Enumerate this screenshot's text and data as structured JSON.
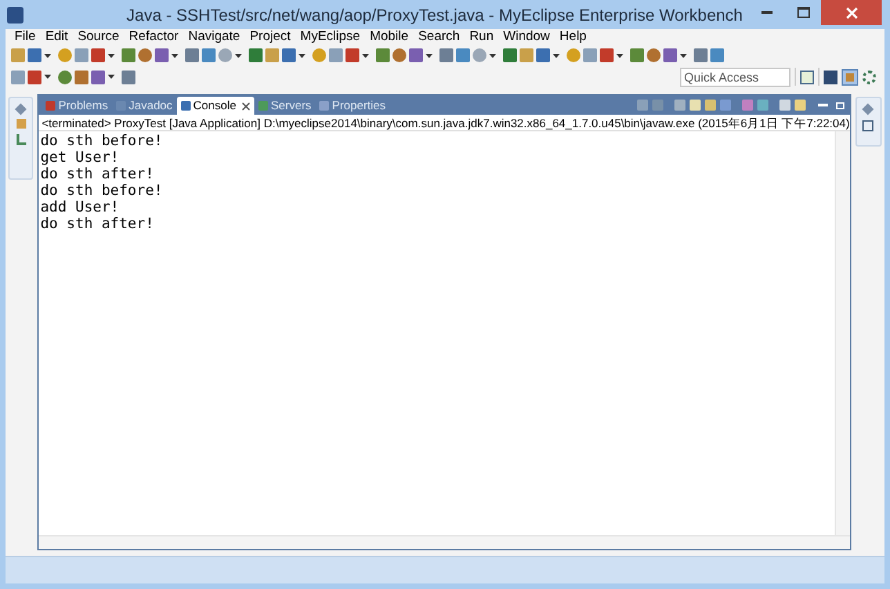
{
  "window": {
    "title": "Java - SSHTest/src/net/wang/aop/ProxyTest.java - MyEclipse Enterprise Workbench"
  },
  "menu": [
    "File",
    "Edit",
    "Source",
    "Refactor",
    "Navigate",
    "Project",
    "MyEclipse",
    "Mobile",
    "Search",
    "Run",
    "Window",
    "Help"
  ],
  "quick_access": {
    "placeholder": "Quick Access"
  },
  "tabs": [
    {
      "label": "Problems",
      "selected": false
    },
    {
      "label": "Javadoc",
      "selected": false
    },
    {
      "label": "Console",
      "selected": true
    },
    {
      "label": "Servers",
      "selected": false
    },
    {
      "label": "Properties",
      "selected": false
    }
  ],
  "console": {
    "header": "<terminated> ProxyTest [Java Application] D:\\myeclipse2014\\binary\\com.sun.java.jdk7.win32.x86_64_1.7.0.u45\\bin\\javaw.exe (2015年6月1日 下午7:22:04)",
    "lines": [
      "do sth before!",
      "get User!",
      "do sth after!",
      "do sth before!",
      "add User!",
      "do sth after!"
    ]
  }
}
